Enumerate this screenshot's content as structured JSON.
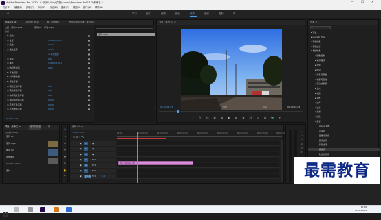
{
  "window": {
    "title": "Adobe Premiere Pro 2020 - C:\\用户\\Mary\\文档\\Adobe\\Premiere Pro\\14.0\\未命名 *",
    "controls": [
      "—",
      "☐",
      "✕"
    ]
  },
  "menu": [
    "文件(F)",
    "编辑(E)",
    "剪辑(C)",
    "序列(S)",
    "标记(M)",
    "图形(G)",
    "视图(V)",
    "窗口(W)",
    "帮助(H)"
  ],
  "workspaces": {
    "home": "⌂",
    "items": [
      "学习",
      "组件",
      "编辑",
      "颜色",
      "效果",
      "音频",
      "图形",
      "库"
    ],
    "active_index": 4
  },
  "effect_controls": {
    "tabs": [
      "效果控件 ≡",
      "Lumetri 范围",
      "源：(无剪辑)",
      "音频剪辑混合器：序列 01"
    ],
    "master": "主要 * 序列.mp4 ▾",
    "sequence": "序列 01 * 序列.mp4",
    "section_video": "视频",
    "rows": [
      {
        "label": "fx 运动",
        "value": ""
      },
      {
        "label": "○ 位置",
        "value": "1280.0   720.0"
      },
      {
        "label": "○ 缩放",
        "value": "100.0"
      },
      {
        "label": "○ 缩放宽度",
        "value": "100.0"
      },
      {
        "label": "",
        "value": "☑ 等比缩放"
      },
      {
        "label": "○ 旋转",
        "value": "0.0"
      },
      {
        "label": "○ 锚点",
        "value": "1280.0   720.0"
      },
      {
        "label": "○ 防闪烁滤镜",
        "value": "0.00"
      },
      {
        "label": "fx 不透明度",
        "value": ""
      },
      {
        "label": "fx 时间重映射",
        "value": ""
      },
      {
        "label": "fx 颜色平衡",
        "value": ""
      },
      {
        "label": "○ 阴影红色平衡",
        "value": "0.0"
      },
      {
        "label": "○ 阴影绿色平衡",
        "value": "0.0"
      },
      {
        "label": "○ 中间调红色平衡",
        "value": "0.0"
      },
      {
        "label": "○ 中间调绿色平衡",
        "value": "0.0 %"
      },
      {
        "label": "○ 高光红色平衡",
        "value": "0.0 %"
      },
      {
        "label": "○ 高光绿色平衡",
        "value": "0.0 %"
      }
    ],
    "timecode": "00:00:01:07",
    "clip_name": "序列.mp4"
  },
  "program": {
    "tab": "节目：序列 01 ≡",
    "timecode_left": "00:00:01:07",
    "fit": "适合",
    "quality": "1/2",
    "timecode_right": "00:00:05:03"
  },
  "transport": [
    "{",
    "}",
    "|◂",
    "◂|",
    "◂",
    "▶",
    "▸",
    "|▸",
    "▸|",
    "⊡",
    "⊞",
    "📷",
    "+"
  ],
  "effects_panel": {
    "tab": "效果 ≡",
    "search_placeholder": "",
    "items": [
      {
        "indent": 0,
        "label": "▸ 预设"
      },
      {
        "indent": 0,
        "label": "▸ Lumetri 预设"
      },
      {
        "indent": 0,
        "label": "▸ 音频效果"
      },
      {
        "indent": 0,
        "label": "▸ 音频过渡"
      },
      {
        "indent": 0,
        "label": "▾ 视频效果"
      },
      {
        "indent": 1,
        "label": "▸ 图像控制"
      },
      {
        "indent": 1,
        "label": "▸ 实用程序"
      },
      {
        "indent": 1,
        "label": "▸ 扭曲"
      },
      {
        "indent": 1,
        "label": "▸ 时间"
      },
      {
        "indent": 1,
        "label": "▸ 杂色与颗粒"
      },
      {
        "indent": 1,
        "label": "▸ 模糊与锐化"
      },
      {
        "indent": 1,
        "label": "▸ 沉浸式视频"
      },
      {
        "indent": 1,
        "label": "▸ 生成"
      },
      {
        "indent": 1,
        "label": "▸ 视频"
      },
      {
        "indent": 1,
        "label": "▸ 调整"
      },
      {
        "indent": 1,
        "label": "▸ 过时"
      },
      {
        "indent": 1,
        "label": "▸ 过渡"
      },
      {
        "indent": 1,
        "label": "▸ 透视"
      },
      {
        "indent": 1,
        "label": "▸ 通道"
      },
      {
        "indent": 1,
        "label": "▾ 键控"
      },
      {
        "indent": 2,
        "label": "Alpha 调整"
      },
      {
        "indent": 2,
        "label": "亮度键"
      },
      {
        "indent": 2,
        "label": "图像遮罩键"
      },
      {
        "indent": 2,
        "label": "差值遮罩"
      },
      {
        "indent": 2,
        "label": "移除遮罩"
      },
      {
        "indent": 2,
        "label": "超级键"
      },
      {
        "indent": 2,
        "label": "轨道遮罩键"
      },
      {
        "indent": 2,
        "label": "非红色键"
      },
      {
        "indent": 2,
        "label": "颜色键"
      },
      {
        "indent": 1,
        "label": "▸ 颜色校正"
      },
      {
        "indent": 1,
        "label": "▸ 风格化"
      },
      {
        "indent": 0,
        "label": "▸ 视频过渡"
      }
    ],
    "highlighted_index": 25
  },
  "project": {
    "tabs": [
      "项目：未命名 ≡",
      "媒体浏览器",
      "库"
    ],
    "name": "未命名.prproj",
    "items": [
      {
        "label": "序列 01"
      },
      {
        "label": "序列.mp4"
      },
      {
        "label": "图层 02"
      },
      {
        "label": "调整图层"
      },
      {
        "label": "Creative Cloud"
      },
      {
        "label": "素材"
      }
    ]
  },
  "timeline": {
    "tab": "序列 01 ≡",
    "timecode": "00:00:01:07",
    "ruler": [
      "00:00",
      "00:00:05:00",
      "00:00:10:00",
      "00:00:15:00",
      "00:00:20:00",
      "00:00:25:00",
      "00:00:30:00",
      "00:00:35:00",
      "00:00:40:00"
    ],
    "tracks": [
      "V3",
      "V2",
      "V1",
      "A1",
      "A2",
      "A3",
      "主声道"
    ],
    "master_value": "0.0",
    "clip_label": "fx 序列.mp4 [V]"
  },
  "watermark": "最需教育",
  "taskbar": {
    "time": "11:36",
    "date": "2021/11/12"
  },
  "colors": {
    "accent": "#4f9ae6",
    "clip": "#d98fd9",
    "bg": "#1d1d1d",
    "panel": "#1f1f1f"
  }
}
